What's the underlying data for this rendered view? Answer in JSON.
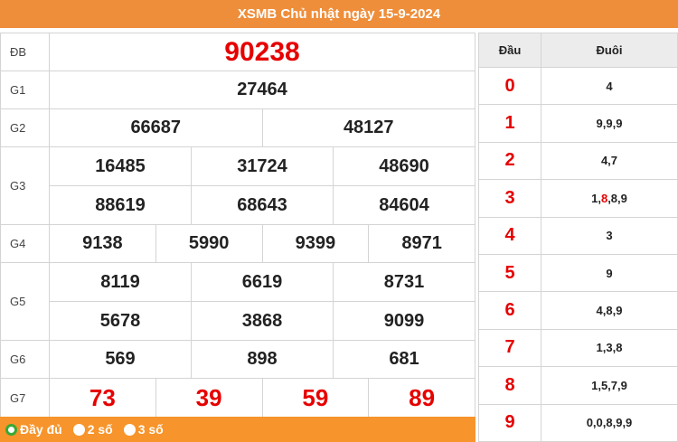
{
  "title": "XSMB Chủ nhật ngày 15-9-2024",
  "prizes": {
    "db": {
      "label": "ĐB",
      "nums": [
        "90238"
      ]
    },
    "g1": {
      "label": "G1",
      "nums": [
        "27464"
      ]
    },
    "g2": {
      "label": "G2",
      "nums": [
        "66687",
        "48127"
      ]
    },
    "g3": {
      "label": "G3",
      "nums": [
        "16485",
        "31724",
        "48690",
        "88619",
        "68643",
        "84604"
      ]
    },
    "g4": {
      "label": "G4",
      "nums": [
        "9138",
        "5990",
        "9399",
        "8971"
      ]
    },
    "g5": {
      "label": "G5",
      "nums": [
        "8119",
        "6619",
        "8731",
        "5678",
        "3868",
        "9099"
      ]
    },
    "g6": {
      "label": "G6",
      "nums": [
        "569",
        "898",
        "681"
      ]
    },
    "g7": {
      "label": "G7",
      "nums": [
        "73",
        "39",
        "59",
        "89"
      ]
    }
  },
  "footer": {
    "options": [
      "Đầy đủ",
      "2 số",
      "3 số"
    ],
    "selected": "Đầy đủ"
  },
  "loto": {
    "head_label": "Đầu",
    "tail_label": "Đuôi",
    "rows": [
      {
        "head": "0",
        "tail": "4"
      },
      {
        "head": "1",
        "tail": "9,9,9"
      },
      {
        "head": "2",
        "tail": "4,7"
      },
      {
        "head": "3",
        "tail_pre": "1,",
        "tail_hl": "8",
        "tail_post": ",8,9"
      },
      {
        "head": "4",
        "tail": "3"
      },
      {
        "head": "5",
        "tail": "9"
      },
      {
        "head": "6",
        "tail": "4,8,9"
      },
      {
        "head": "7",
        "tail": "1,3,8"
      },
      {
        "head": "8",
        "tail": "1,5,7,9"
      },
      {
        "head": "9",
        "tail": "0,0,8,9,9"
      }
    ]
  },
  "colors": {
    "accent": "#f7942b",
    "header": "#ef8e3a",
    "highlight": "#e60000",
    "radio_on": "#39a935"
  }
}
